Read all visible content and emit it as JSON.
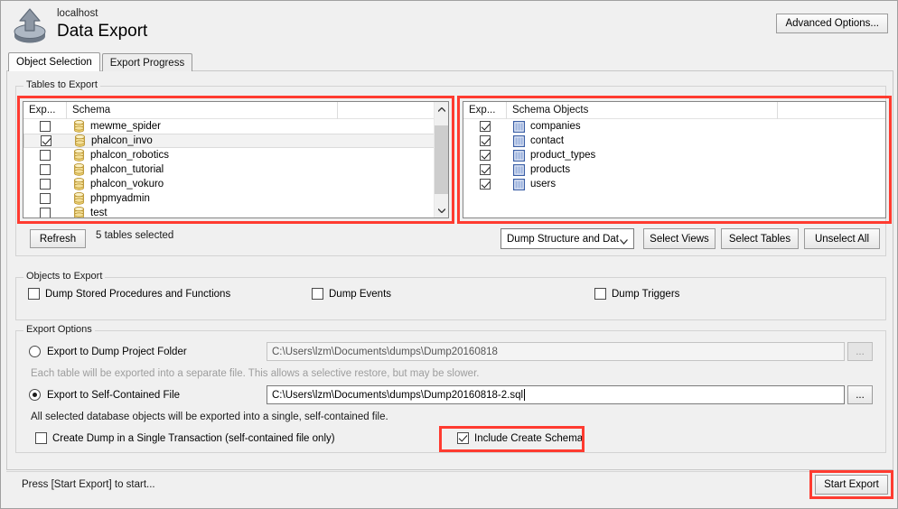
{
  "header": {
    "icon": "export-db-icon",
    "host": "localhost",
    "title": "Data Export",
    "advanced_options_label": "Advanced Options..."
  },
  "tabs": [
    {
      "label": "Object Selection",
      "active": true
    },
    {
      "label": "Export Progress",
      "active": false
    }
  ],
  "groups": {
    "tables_to_export": "Tables to Export",
    "objects_to_export": "Objects to Export",
    "export_options": "Export Options"
  },
  "schema_list": {
    "columns": [
      "Exp...",
      "Schema"
    ],
    "rows": [
      {
        "checked": false,
        "selected": false,
        "name": "mewme_spider",
        "icon": "database-icon"
      },
      {
        "checked": true,
        "selected": true,
        "name": "phalcon_invo",
        "icon": "database-icon"
      },
      {
        "checked": false,
        "selected": false,
        "name": "phalcon_robotics",
        "icon": "database-icon"
      },
      {
        "checked": false,
        "selected": false,
        "name": "phalcon_tutorial",
        "icon": "database-icon"
      },
      {
        "checked": false,
        "selected": false,
        "name": "phalcon_vokuro",
        "icon": "database-icon"
      },
      {
        "checked": false,
        "selected": false,
        "name": "phpmyadmin",
        "icon": "database-icon"
      },
      {
        "checked": false,
        "selected": false,
        "name": "test",
        "icon": "database-icon"
      }
    ]
  },
  "objects_list": {
    "columns": [
      "Exp...",
      "Schema Objects"
    ],
    "rows": [
      {
        "checked": true,
        "name": "companies",
        "icon": "table-icon"
      },
      {
        "checked": true,
        "name": "contact",
        "icon": "table-icon"
      },
      {
        "checked": true,
        "name": "product_types",
        "icon": "table-icon"
      },
      {
        "checked": true,
        "name": "products",
        "icon": "table-icon"
      },
      {
        "checked": true,
        "name": "users",
        "icon": "table-icon"
      }
    ]
  },
  "toolbar": {
    "refresh_label": "Refresh",
    "selection_status": "5 tables selected",
    "dump_mode_selected": "Dump Structure and Dat",
    "select_views_label": "Select Views",
    "select_tables_label": "Select Tables",
    "unselect_all_label": "Unselect All"
  },
  "objects_to_export": [
    {
      "label": "Dump Stored Procedures and Functions",
      "checked": false
    },
    {
      "label": "Dump Events",
      "checked": false
    },
    {
      "label": "Dump Triggers",
      "checked": false
    }
  ],
  "export_options": {
    "folder": {
      "label": "Export to Dump Project Folder",
      "selected": false,
      "path": "C:\\Users\\lzm\\Documents\\dumps\\Dump20160818",
      "browse_label": "...",
      "hint": "Each table will be exported into a separate file. This allows a selective restore, but may be slower."
    },
    "file": {
      "label": "Export to Self-Contained File",
      "selected": true,
      "path": "C:\\Users\\lzm\\Documents\\dumps\\Dump20160818-2.sql",
      "browse_label": "...",
      "hint": "All selected database objects will be exported into a single, self-contained file."
    },
    "single_transaction": {
      "label": "Create Dump in a Single Transaction (self-contained file only)",
      "checked": false
    },
    "include_create_schema": {
      "label": "Include Create Schema",
      "checked": true
    }
  },
  "footer": {
    "status": "Press [Start Export] to start...",
    "start_export_label": "Start Export"
  },
  "colors": {
    "highlight_red": "#ff3b30",
    "window_bg": "#f0f0f0",
    "list_bg": "#ffffff",
    "db_icon_yellow": "#e8c55a",
    "table_icon_blue": "#5a7fc0"
  }
}
